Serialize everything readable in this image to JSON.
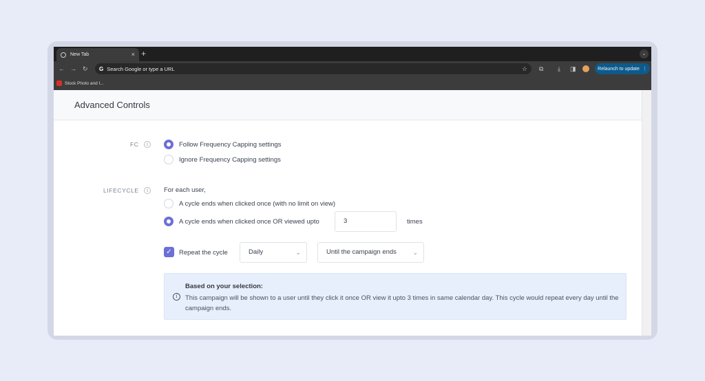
{
  "browser": {
    "tab_title": "New Tab",
    "tab_close": "×",
    "new_tab": "+",
    "omnibox_placeholder": "Search Google or type a URL",
    "relaunch_label": "Relaunch to update",
    "bookmark_label": "Stock Photo and I..."
  },
  "page": {
    "title": "Advanced Controls",
    "fc": {
      "label": "FC",
      "options": [
        "Follow Frequency Capping settings",
        "Ignore Frequency Capping settings"
      ],
      "selected_index": 0
    },
    "lifecycle": {
      "label": "LIFECYCLE",
      "intro": "For each user,",
      "options": [
        "A cycle ends when clicked once (with no limit on view)",
        "A cycle ends when clicked once OR viewed upto"
      ],
      "selected_index": 1,
      "view_count": "3",
      "times_label": "times",
      "repeat_label": "Repeat the cycle",
      "repeat_checked": true,
      "frequency_value": "Daily",
      "until_value": "Until the campaign ends"
    },
    "summary": {
      "title": "Based on your selection:",
      "text": "This campaign will be shown to a user until they click it once OR view it upto 3 times in same calendar day. This cycle would repeat every day until the campaign ends."
    }
  },
  "colors": {
    "accent": "#6b70d6",
    "background": "#e8ebf8",
    "info_box": "#e8effc",
    "relaunch": "#0e5a8a"
  }
}
